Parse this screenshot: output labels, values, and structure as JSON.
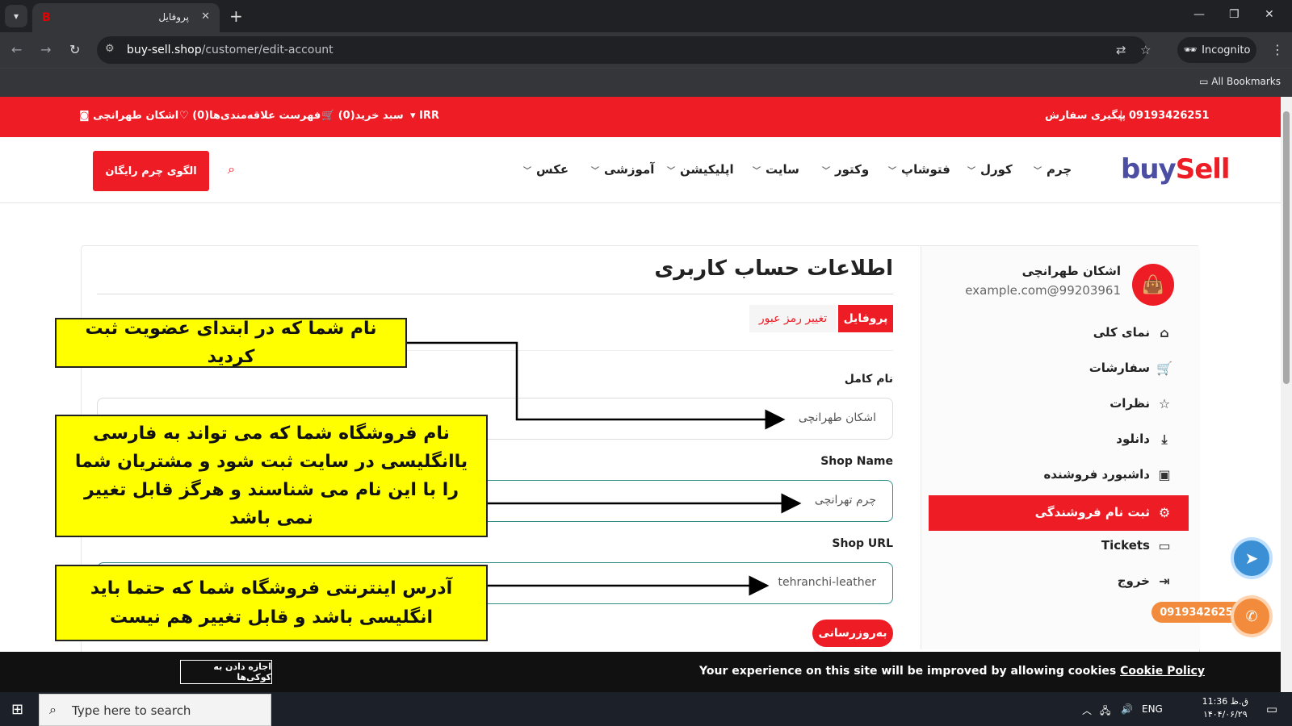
{
  "browser": {
    "tab_title": "پروفایل",
    "url_domain": "buy-sell.shop",
    "url_path": "/customer/edit-account",
    "incognito_label": "Incognito",
    "bookmarks_label": "All Bookmarks"
  },
  "topbar": {
    "phone": "09193426251",
    "track_order": "پیگیری سفارش",
    "currency": "IRR",
    "cart": "سبد خرید(0)",
    "wishlist": "فهرست علاقه‌مندی‌ها(0)",
    "user": "اشکان طهرانچی"
  },
  "header": {
    "logo_buy": "buy",
    "logo_sell": "Sell",
    "menu": [
      "چرم",
      "کورل",
      "فتوشاپ",
      "وکتور",
      "سایت",
      "اپلیکیشن",
      "آموزشی",
      "عکس"
    ],
    "cta": "الگوی چرم رایگان"
  },
  "sidebar": {
    "name": "اشکان طهرانچی",
    "email": "example.com@99203961",
    "items": [
      {
        "label": "نمای کلی",
        "icon": "home-icon"
      },
      {
        "label": "سفارشات",
        "icon": "cart-icon"
      },
      {
        "label": "نظرات",
        "icon": "star-icon"
      },
      {
        "label": "دانلود",
        "icon": "download-icon"
      },
      {
        "label": "داشبورد فروشنده",
        "icon": "briefcase-icon"
      },
      {
        "label": "ثبت نام فروشندگی",
        "icon": "gear-icon"
      },
      {
        "label": "Tickets",
        "icon": "ticket-icon"
      },
      {
        "label": "خروج",
        "icon": "logout-icon"
      }
    ]
  },
  "main": {
    "title": "اطلاعات حساب کاربری",
    "tab_profile": "پروفایل",
    "tab_password": "تغییر رمز عبور",
    "full_name_label": "نام کامل",
    "full_name_value": "اشکان طهرانچی",
    "shop_name_label": "Shop Name",
    "shop_name_value": "چرم تهرانچی",
    "shop_url_label": "Shop URL",
    "shop_url_value": "tehranchi-leather",
    "update_button": "به‌روزرسانی"
  },
  "annotations": {
    "note1": "نام شما که در ابتدای عضویت ثبت کردید",
    "note2": "نام فروشگاه شما که می تواند به فارسی یاانگلیسی در سایت ثبت شود و مشتریان شما را با این نام می شناسند و هرگز قابل تغییر نمی باشد",
    "note3": "آدرس اینترنتی فروشگاه شما که حتما باید انگلیسی باشد و قابل تغییر هم نیست"
  },
  "floating": {
    "phone": "09193426251"
  },
  "cookie": {
    "message": "Your experience on this site will be improved by allowing cookies",
    "policy_link": "Cookie Policy",
    "allow_button": "اجازه دادن به کوکی‌ها"
  },
  "taskbar": {
    "search_placeholder": "Type here to search",
    "lang": "ENG",
    "time": "11:36 ق.ظ",
    "date": "۱۴۰۴/۰۶/۲۹"
  },
  "colors": {
    "brand_red": "#ee1c25",
    "annotation_yellow": "#ffff00",
    "brand_blue": "#4b4ea3"
  }
}
